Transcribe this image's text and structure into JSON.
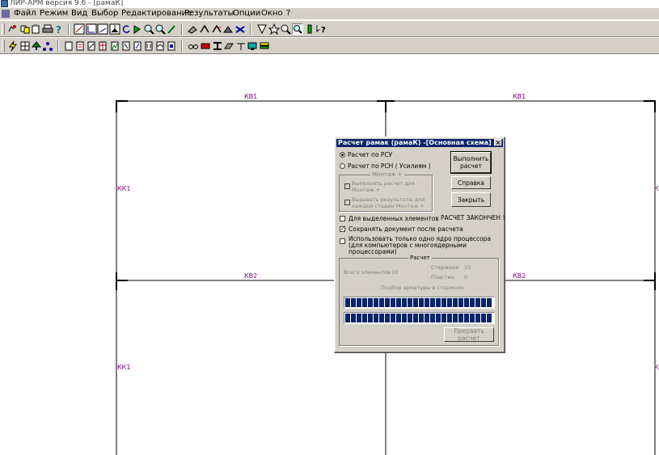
{
  "window": {
    "title": "ЛИР-АРМ версия 9.6 - [рамаК]"
  },
  "menu": [
    "Файл",
    "Режим",
    "Вид",
    "Выбор",
    "Редактирование",
    "Результаты",
    "Опции",
    "Окно",
    "?"
  ],
  "canvas": {
    "beam_labels": [
      "КВ1",
      "КВ1",
      "КВ2",
      "КВ2"
    ],
    "column_labels": [
      "КК1",
      "КК1",
      "К",
      "К"
    ],
    "line_color": "#000000",
    "label_color": "#800080"
  },
  "dialog": {
    "title": "Расчет рамак (рамаК) -[Основная схема]",
    "close_label": "×",
    "radio_rsu": "Расчет по РСУ",
    "radio_rsn": "Расчет по РСН ( Усилиям )",
    "montazh_group": "Монтаж +",
    "montazh_calc": "Выполнять расчет для Монтаж +",
    "montazh_results": "Выдавать результаты для каждой стадии Монтаж +",
    "chk_selected": "Для выделенных элементов",
    "chk_save": "Сохранять документ после расчета",
    "chk_single_core": "Использовать только одно ядро процессора (для компьютеров с многоядерными процессорами)",
    "btn_run": "Выполнить расчет",
    "btn_help": "Справка",
    "btn_close": "Закрыть",
    "status": "РАСЧЕТ ЗАКОНЧЕН !",
    "calc_group": "Расчет",
    "total_label": "Всего элементов",
    "total_value": "10",
    "rods_label": "Стержней",
    "rods_value": "10",
    "plates_label": "Пластин",
    "plates_value": "0",
    "progress_caption": "Подбор арматуры в стержнях",
    "progress_1": 1.0,
    "progress_2": 1.0,
    "progress_color": "#0a246a",
    "btn_abort": "Прервать расчет",
    "rsu_selected": true,
    "save_checked": true
  }
}
